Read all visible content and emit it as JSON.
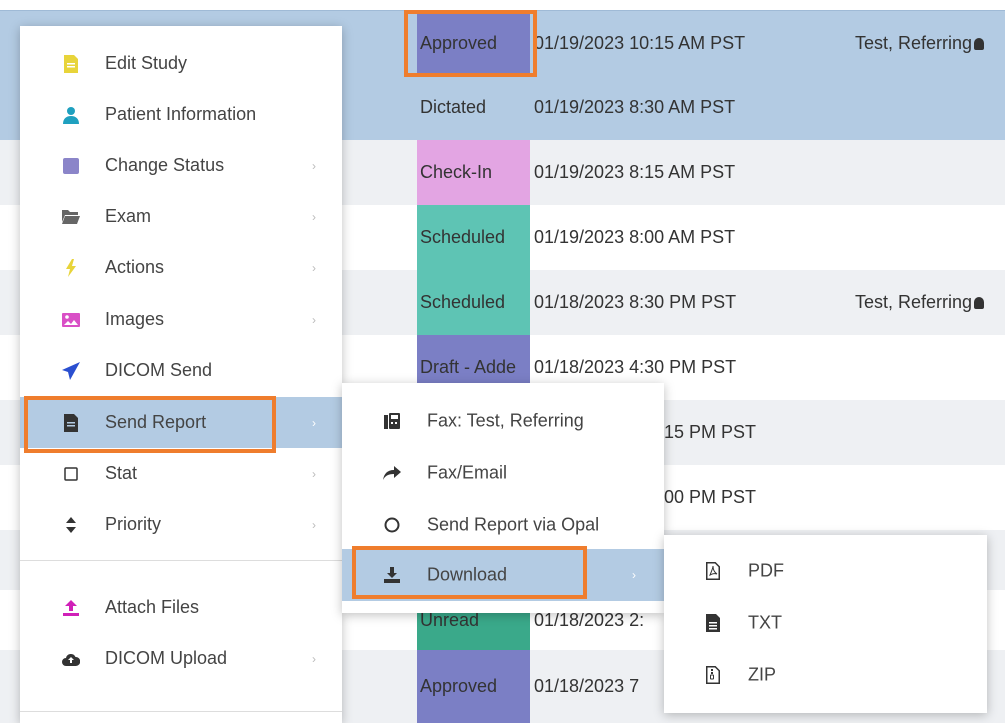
{
  "colors": {
    "approved": "#7b7fc5",
    "dictated": "#b3cbe3",
    "checkin": "#e3a5e3",
    "scheduled": "#5ec4b4",
    "draft": "#7b7fc5",
    "unread": "#3aa98a",
    "highlight": "#ef7d2d",
    "selected_row": "#b3cbe3"
  },
  "worklist": {
    "rows": [
      {
        "status": "Approved",
        "date": "01/19/2023 10:15 AM PST",
        "referring": "Test, Referring"
      },
      {
        "status": "Dictated",
        "date": "01/19/2023 8:30 AM PST",
        "referring": ""
      },
      {
        "status": "Check-In",
        "date": "01/19/2023 8:15 AM PST",
        "referring": ""
      },
      {
        "status": "Scheduled",
        "date": "01/19/2023 8:00 AM PST",
        "referring": ""
      },
      {
        "status": "Scheduled",
        "date": "01/18/2023 8:30 PM PST",
        "referring": "Test, Referring"
      },
      {
        "status": "Draft - Adde",
        "date": "01/18/2023 4:30 PM PST",
        "referring": ""
      },
      {
        "status": "",
        "date": "15 PM PST",
        "referring": ""
      },
      {
        "status": "",
        "date": "00 PM PST",
        "referring": ""
      },
      {
        "status": "",
        "date": "",
        "referring": ""
      },
      {
        "status": "Unread",
        "date": "01/18/2023 2:",
        "referring": ""
      },
      {
        "status": "Approved",
        "date": "01/18/2023 7",
        "referring": ""
      }
    ]
  },
  "menu": {
    "items": [
      {
        "label": "Edit Study",
        "icon": "edit-study-icon"
      },
      {
        "label": "Patient Information",
        "icon": "patient-icon"
      },
      {
        "label": "Change Status",
        "icon": "status-square-icon",
        "submenu": true
      },
      {
        "label": "Exam",
        "icon": "folder-icon",
        "submenu": true
      },
      {
        "label": "Actions",
        "icon": "lightning-icon",
        "submenu": true
      },
      {
        "label": "Images",
        "icon": "image-icon",
        "submenu": true
      },
      {
        "label": "DICOM Send",
        "icon": "paper-plane-icon"
      },
      {
        "label": "Send Report",
        "icon": "report-icon",
        "submenu": true,
        "active": true
      },
      {
        "label": "Stat",
        "icon": "checkbox-icon",
        "submenu": true
      },
      {
        "label": "Priority",
        "icon": "sort-icon",
        "submenu": true
      },
      {
        "label": "Attach Files",
        "icon": "upload-icon"
      },
      {
        "label": "DICOM Upload",
        "icon": "cloud-upload-icon",
        "submenu": true
      }
    ],
    "arrow": "›"
  },
  "send_report_menu": {
    "items": [
      {
        "label": "Fax: Test, Referring",
        "icon": "fax-icon"
      },
      {
        "label": "Fax/Email",
        "icon": "share-arrow-icon"
      },
      {
        "label": "Send Report via Opal",
        "icon": "circle-icon"
      },
      {
        "label": "Download",
        "icon": "download-icon",
        "active": true
      }
    ],
    "arrow": "›"
  },
  "download_menu": {
    "items": [
      {
        "label": "PDF",
        "icon": "pdf-file-icon"
      },
      {
        "label": "TXT",
        "icon": "txt-file-icon"
      },
      {
        "label": "ZIP",
        "icon": "zip-file-icon"
      }
    ]
  }
}
